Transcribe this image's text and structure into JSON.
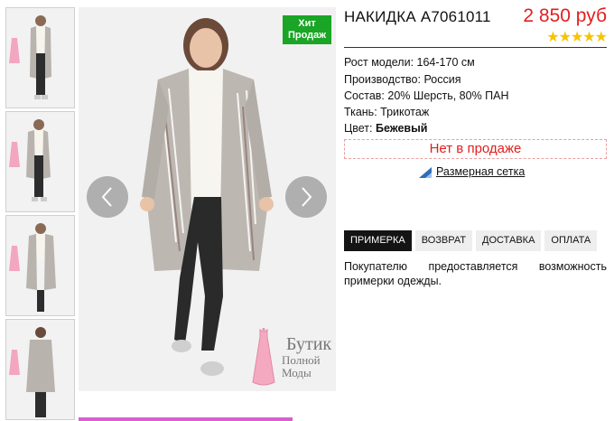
{
  "product": {
    "title": "НАКИДКА А7061011",
    "price": "2 850 руб",
    "rating": 5,
    "stars": "★★★★★",
    "badge": "Хит Продаж",
    "colors": {
      "price": "#e02020",
      "badge": "#1aa526",
      "stars": "#f5c400",
      "accent_bar": "#d95fd0"
    }
  },
  "specs": [
    {
      "label": "Рост модели:",
      "value": "164-170 см"
    },
    {
      "label": "Производство:",
      "value": "Россия"
    },
    {
      "label": "Состав:",
      "value": "20% Шерсть, 80% ПАН"
    },
    {
      "label": "Ткань:",
      "value": "Трикотаж"
    },
    {
      "label": "Цвет:",
      "value": "Бежевый"
    }
  ],
  "availability": "Нет в продаже",
  "size_chart_link": "Размерная сетка",
  "tabs": [
    {
      "label": "ПРИМЕРКА",
      "active": true
    },
    {
      "label": "ВОЗВРАТ",
      "active": false
    },
    {
      "label": "ДОСТАВКА",
      "active": false
    },
    {
      "label": "ОПЛАТА",
      "active": false
    }
  ],
  "tab_content": "Покупателю предоставляется возможность примерки одежды.",
  "brand": {
    "line1": "Бутик",
    "line2": "Полной",
    "line3": "Моды"
  },
  "gallery": {
    "thumbnail_count": 4,
    "icons": [
      "chevron-left-icon",
      "chevron-right-icon"
    ]
  }
}
